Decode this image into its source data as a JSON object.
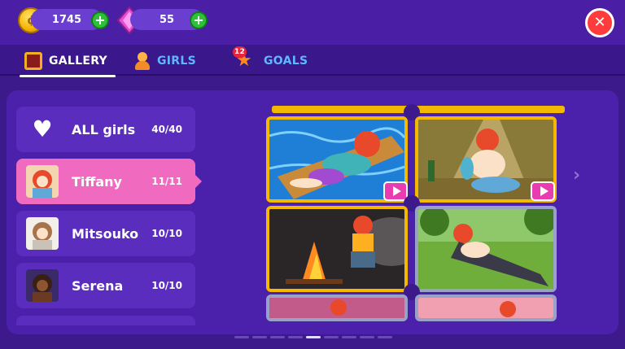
{
  "currency": {
    "coins": "1745",
    "gems": "55",
    "coin_icon": "coin-icon",
    "gem_icon": "gem-icon",
    "plus_label": "+"
  },
  "close_label": "✕",
  "tabs": [
    {
      "label": "GALLERY",
      "icon": "gallery-icon",
      "active": true
    },
    {
      "label": "GIRLS",
      "icon": "girl-icon",
      "active": false
    },
    {
      "label": "GOALS",
      "icon": "star-icon",
      "active": false,
      "badge": "12"
    }
  ],
  "girls": [
    {
      "name": "ALL girls",
      "count": "40/40",
      "icon": "heart-icon"
    },
    {
      "name": "Tiffany",
      "count": "11/11",
      "selected": true
    },
    {
      "name": "Mitsouko",
      "count": "10/10"
    },
    {
      "name": "Serena",
      "count": "10/10"
    }
  ],
  "gallery": {
    "cards": [
      {
        "frame": "gold",
        "scene": "raft-on-water",
        "video": true
      },
      {
        "frame": "gold",
        "scene": "tent-with-bottle",
        "video": true
      },
      {
        "frame": "gold",
        "scene": "campfire-night",
        "video": false
      },
      {
        "frame": "silver",
        "scene": "forest-clearing",
        "video": false
      },
      {
        "frame": "silver",
        "scene": "pink-scene",
        "video": false
      },
      {
        "frame": "silver",
        "scene": "pink-scene",
        "video": false
      }
    ],
    "next_icon": "chevron-right-icon"
  },
  "pager": {
    "total": 9,
    "active_index": 4
  },
  "colors": {
    "background": "#3d1a8c",
    "selected_row": "#f06bbf",
    "gold_frame": "#f5b800",
    "tab_inactive": "#5fb8ff"
  }
}
